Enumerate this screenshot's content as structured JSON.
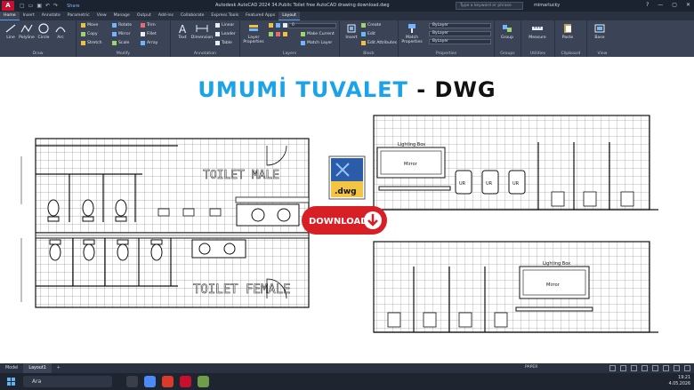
{
  "window": {
    "app_logo": "A",
    "share_label": "Share",
    "title": "Autodesk AutoCAD 2024   34.Public Toilet free AutoCAD drawing download.dwg",
    "search_placeholder": "Type a keyword or phrase",
    "user": "mimarlucky",
    "help": "?"
  },
  "tabs": [
    "Home",
    "Insert",
    "Annotate",
    "Parametric",
    "View",
    "Manage",
    "Output",
    "Add-ins",
    "Collaborate",
    "Express Tools",
    "Featured Apps",
    "Layout"
  ],
  "ribbon": {
    "draw": {
      "label": "Draw",
      "tools": [
        "Line",
        "Polyline",
        "Circle",
        "Arc"
      ]
    },
    "modify": {
      "label": "Modify",
      "tools": [
        "Move",
        "Rotate",
        "Trim",
        "Copy",
        "Mirror",
        "Fillet",
        "Stretch",
        "Scale",
        "Array"
      ]
    },
    "annotation": {
      "label": "Annotation",
      "tools": [
        "Text",
        "Dimension",
        "Linear",
        "Leader",
        "Table"
      ]
    },
    "layers": {
      "label": "Layers",
      "big": "Layer Properties",
      "layer_value": "0",
      "tools": [
        "Make Current",
        "Match Layer"
      ]
    },
    "block": {
      "label": "Block",
      "big": "Insert",
      "tools": [
        "Create",
        "Edit",
        "Edit Attributes"
      ]
    },
    "properties": {
      "label": "Properties",
      "big": "Match Properties",
      "bylayer": "ByLayer"
    },
    "groups": {
      "label": "Groups",
      "big": "Group"
    },
    "utilities": {
      "label": "Utilities",
      "big": "Measure"
    },
    "clipboard": {
      "label": "Clipboard",
      "big": "Paste"
    },
    "view": {
      "label": "View",
      "big": "Base"
    }
  },
  "drawing": {
    "heading_a": "UMUMİ TUVALET",
    "heading_b": " - DWG",
    "toilet_male": "TOILET MALE",
    "toilet_female": "TOILET FEMALE",
    "lighting_box": "Lighting Box",
    "mirror": "Mirror",
    "urinal": "UR",
    "download": "DOWNLOAD",
    "dwg_label": ".dwg"
  },
  "layout_tabs": [
    "Model",
    "Layout1"
  ],
  "status": {
    "paper": "PAPER"
  },
  "taskbar": {
    "search": "Ara",
    "time": "19:21",
    "date": "4.05.2026"
  },
  "colors": {
    "heading_blue": "#1aa3e8",
    "download_red": "#d81f26",
    "ribbon_bg": "#3b4456"
  }
}
